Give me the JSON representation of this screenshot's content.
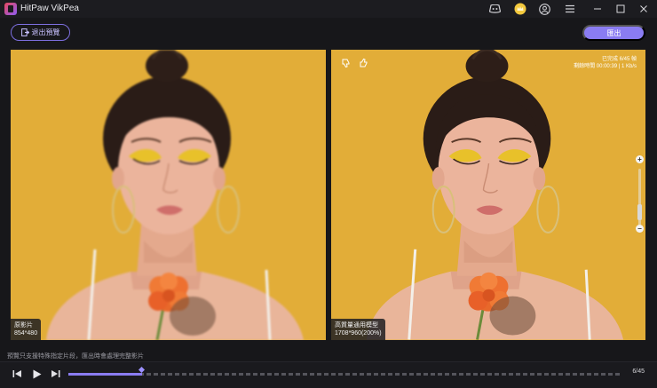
{
  "app": {
    "title": "HitPaw VikPea"
  },
  "toolbar": {
    "exit_preview_label": "退出預覽",
    "export_label": "匯出"
  },
  "left_pane": {
    "label": "原影片",
    "resolution": "854*480"
  },
  "right_pane": {
    "model_label": "高質量通用模型",
    "resolution": "1708*960(200%)",
    "progress": {
      "completed": "已完成 6/45 幀",
      "remaining": "剩餘時間 00:00:39 | 1 Kb/s"
    }
  },
  "footer": {
    "hint": "預覽只支援特殊指定片段，匯出時會處理完整影片",
    "frame_counter": "6/45"
  },
  "playback": {
    "progress_fraction": 0.1333
  },
  "colors": {
    "accent": "#8a7cf2",
    "background": "#17171a",
    "photo_bg": "#e0ad3a"
  }
}
